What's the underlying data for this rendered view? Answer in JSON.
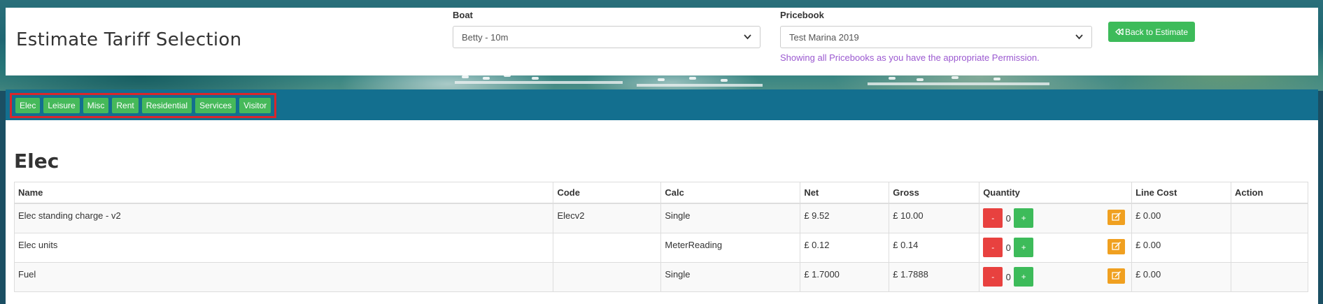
{
  "header": {
    "title": "Estimate Tariff Selection",
    "boat_label": "Boat",
    "boat_value": "Betty - 10m",
    "pricebook_label": "Pricebook",
    "pricebook_value": "Test Marina 2019",
    "permission_note": "Showing all Pricebooks as you have the appropriate Permission.",
    "back_button": "Back to Estimate"
  },
  "categories": [
    "Elec",
    "Leisure",
    "Misc",
    "Rent",
    "Residential",
    "Services",
    "Visitor"
  ],
  "section_title": "Elec",
  "table": {
    "columns": [
      "Name",
      "Code",
      "Calc",
      "Net",
      "Gross",
      "Quantity",
      "Line Cost",
      "Action"
    ],
    "rows": [
      {
        "name": "Elec standing charge - v2",
        "code": "Elecv2",
        "calc": "Single",
        "net": "£ 9.52",
        "gross": "£ 10.00",
        "quantity": "0",
        "line_cost": "£ 0.00"
      },
      {
        "name": "Elec units",
        "code": "",
        "calc": "MeterReading",
        "net": "£ 0.12",
        "gross": "£ 0.14",
        "quantity": "0",
        "line_cost": "£ 0.00"
      },
      {
        "name": "Fuel",
        "code": "",
        "calc": "Single",
        "net": "£ 1.7000",
        "gross": "£ 1.7888",
        "quantity": "0",
        "line_cost": "£ 0.00"
      }
    ],
    "minus_label": "-",
    "plus_label": "+"
  },
  "colors": {
    "category_bar": "#136f8f",
    "category_button": "#46b95a",
    "highlight_border": "#d9262c",
    "minus_button": "#e8413f",
    "plus_button": "#3dbb5a",
    "edit_button": "#f0a020",
    "permission_text": "#9b59d0"
  },
  "icons": {
    "back": "rewind-icon",
    "select": "chevron-down-icon",
    "edit": "edit-icon"
  }
}
